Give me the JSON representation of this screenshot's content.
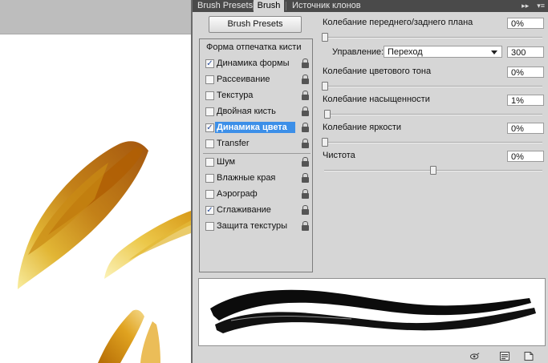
{
  "tabs": [
    {
      "label": "Brush Presets",
      "active": false
    },
    {
      "label": "Brush",
      "active": true
    },
    {
      "label": "Источник клонов",
      "active": false
    }
  ],
  "panel_controls": {
    "collapse": "▸▸",
    "menu": "▾≡"
  },
  "presets_button": "Brush Presets",
  "options_header": "Форма отпечатка кисти",
  "options": [
    {
      "label": "Динамика формы",
      "checked": "✓",
      "locked": true
    },
    {
      "label": "Рассеивание",
      "checked": "",
      "locked": true
    },
    {
      "label": "Текстура",
      "checked": "",
      "locked": true
    },
    {
      "label": "Двойная кисть",
      "checked": "",
      "locked": true
    },
    {
      "label": "Динамика цвета",
      "checked": "✓",
      "locked": true,
      "selected": true
    },
    {
      "label": "Transfer",
      "checked": "",
      "locked": true
    },
    {
      "label": "Шум",
      "checked": "",
      "locked": true
    },
    {
      "label": "Влажные края",
      "checked": "",
      "locked": true
    },
    {
      "label": "Аэрограф",
      "checked": "",
      "locked": true
    },
    {
      "label": "Сглаживание",
      "checked": "✓",
      "locked": true
    },
    {
      "label": "Защита текстуры",
      "checked": "",
      "locked": true
    }
  ],
  "settings": {
    "fg_bg_jitter": {
      "label": "Колебание переднего/заднего плана",
      "value": "0%",
      "slider_fraction": 0
    },
    "control": {
      "label": "Управление:",
      "selected": "Переход",
      "steps": "300"
    },
    "hue_jitter": {
      "label": "Колебание цветового тона",
      "value": "0%",
      "slider_fraction": 0
    },
    "saturation_jitter": {
      "label": "Колебание насыщенности",
      "value": "1%",
      "slider_fraction": 0.01
    },
    "brightness_jitter": {
      "label": "Колебание яркости",
      "value": "0%",
      "slider_fraction": 0
    },
    "purity": {
      "label": "Чистота",
      "value": "0%",
      "slider_fraction": 0.5
    }
  },
  "colors": {
    "selection": "#3c8fe8",
    "panel": "#d6d6d6",
    "tabbar": "#4a4a4a",
    "stroke_dark": "#a85a05",
    "stroke_light": "#f4e27a"
  },
  "bottom_icons": [
    "eye-toggle-icon",
    "new-preset-icon",
    "create-new-icon"
  ]
}
